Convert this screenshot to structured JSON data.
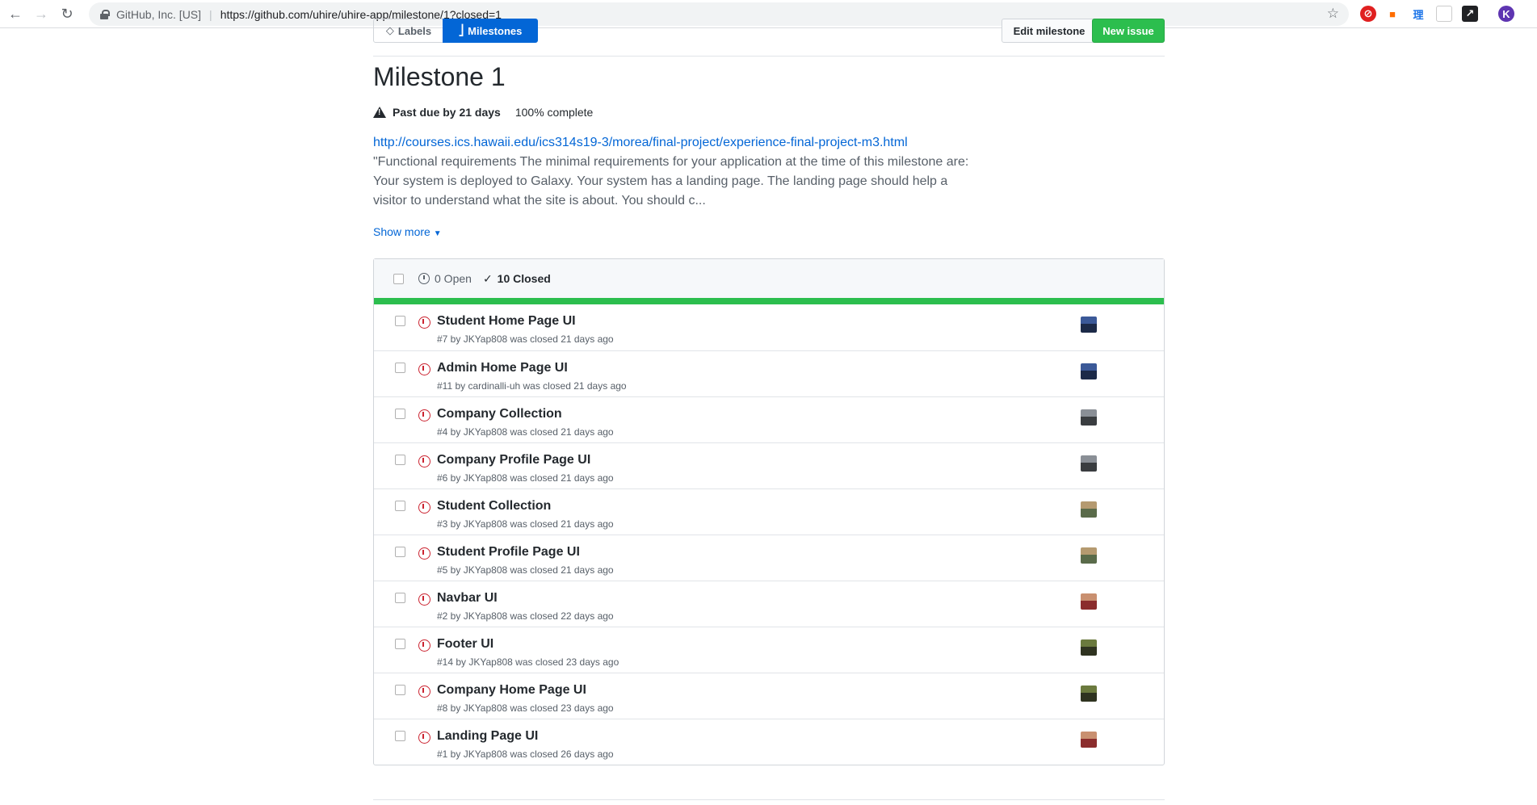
{
  "browser": {
    "org": "GitHub, Inc. [US]",
    "url": "https://github.com/uhire/uhire-app/milestone/1?closed=1",
    "profile_initial": "K",
    "ext_label": "理"
  },
  "subnav": {
    "labels": "Labels",
    "milestones": "Milestones",
    "edit": "Edit milestone",
    "new_issue": "New issue"
  },
  "milestone": {
    "title": "Milestone 1",
    "due": "Past due by 21 days",
    "complete": "100% complete",
    "link": "http://courses.ics.hawaii.edu/ics314s19-3/morea/final-project/experience-final-project-m3.html",
    "description": "\"Functional requirements The minimal requirements for your application at the time of this milestone are: Your system is deployed to Galaxy. Your system has a landing page. The landing page should help a visitor to understand what the site is about. You should c...",
    "show_more": "Show more"
  },
  "states": {
    "open": "0 Open",
    "closed": "10 Closed",
    "progress_fraction": 1.0
  },
  "issues": [
    {
      "title": "Student Home Page UI",
      "meta": "#7 by JKYap808 was closed 21 days ago"
    },
    {
      "title": "Admin Home Page UI",
      "meta": "#11 by cardinalli-uh was closed 21 days ago"
    },
    {
      "title": "Company Collection",
      "meta": "#4 by JKYap808 was closed 21 days ago"
    },
    {
      "title": "Company Profile Page UI",
      "meta": "#6 by JKYap808 was closed 21 days ago"
    },
    {
      "title": "Student Collection",
      "meta": "#3 by JKYap808 was closed 21 days ago"
    },
    {
      "title": "Student Profile Page UI",
      "meta": "#5 by JKYap808 was closed 21 days ago"
    },
    {
      "title": "Navbar UI",
      "meta": "#2 by JKYap808 was closed 22 days ago"
    },
    {
      "title": "Footer UI",
      "meta": "#14 by JKYap808 was closed 23 days ago"
    },
    {
      "title": "Company Home Page UI",
      "meta": "#8 by JKYap808 was closed 23 days ago"
    },
    {
      "title": "Landing Page UI",
      "meta": "#1 by JKYap808 was closed 26 days ago"
    }
  ],
  "colors": {
    "accent": "#0366d6",
    "success": "#2cbe4e",
    "closed_issue": "#cb2431"
  }
}
